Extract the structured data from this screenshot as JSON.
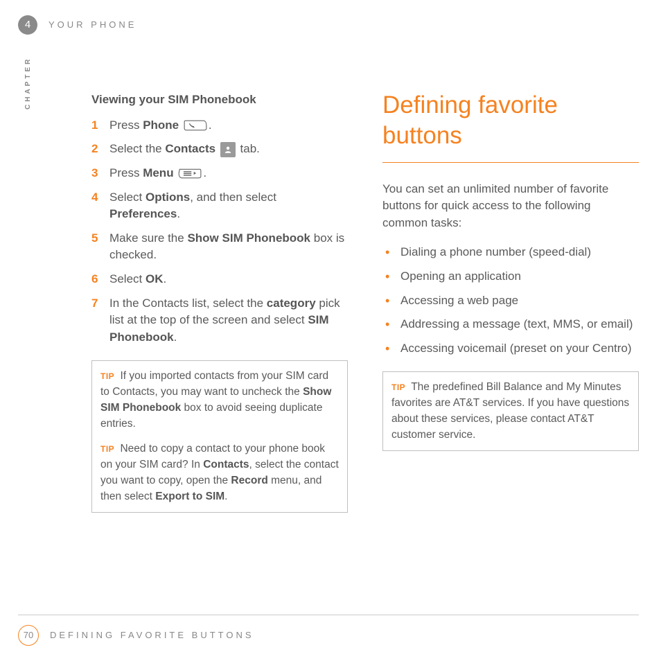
{
  "header": {
    "chapter_number": "4",
    "title": "YOUR PHONE",
    "vertical_label": "CHAPTER"
  },
  "left": {
    "heading": "Viewing your SIM Phonebook",
    "steps": {
      "s1_a": "Press ",
      "s1_b": "Phone",
      "s1_c": ".",
      "s2_a": "Select the ",
      "s2_b": "Contacts",
      "s2_c": " tab.",
      "s3_a": "Press ",
      "s3_b": "Menu",
      "s3_c": ".",
      "s4_a": "Select ",
      "s4_b": "Options",
      "s4_c": ", and then select ",
      "s4_d": "Preferences",
      "s4_e": ".",
      "s5_a": "Make sure the ",
      "s5_b": "Show SIM Phonebook",
      "s5_c": " box is checked.",
      "s6_a": "Select ",
      "s6_b": "OK",
      "s6_c": ".",
      "s7_a": "In the Contacts list, select the ",
      "s7_b": "category",
      "s7_c": " pick list at the top of the screen and select ",
      "s7_d": "SIM Phonebook",
      "s7_e": "."
    },
    "tip1": {
      "label": "TIP",
      "t1": " If you imported contacts from your SIM card to Contacts, you may want to uncheck the ",
      "t2": "Show SIM Phonebook",
      "t3": " box to avoid seeing duplicate entries."
    },
    "tip2": {
      "label": "TIP",
      "t1": " Need to copy a contact to your phone book on your SIM card? In ",
      "t2": "Contacts",
      "t3": ", select the contact you want to copy, open the ",
      "t4": "Record",
      "t5": " menu, and then select ",
      "t6": "Export to SIM",
      "t7": "."
    }
  },
  "right": {
    "title": "Defining favorite buttons",
    "intro": "You can set an unlimited number of favorite buttons for quick access to the following common tasks:",
    "bullets": [
      "Dialing a phone number (speed-dial)",
      "Opening an application",
      "Accessing a web page",
      "Addressing a message (text, MMS, or email)",
      "Accessing voicemail (preset on your Centro)"
    ],
    "tip": {
      "label": "TIP",
      "text": " The predefined Bill Balance and My Minutes favorites are AT&T services. If you have questions about these services, please contact AT&T customer service."
    }
  },
  "footer": {
    "page": "70",
    "title": "DEFINING FAVORITE BUTTONS"
  }
}
